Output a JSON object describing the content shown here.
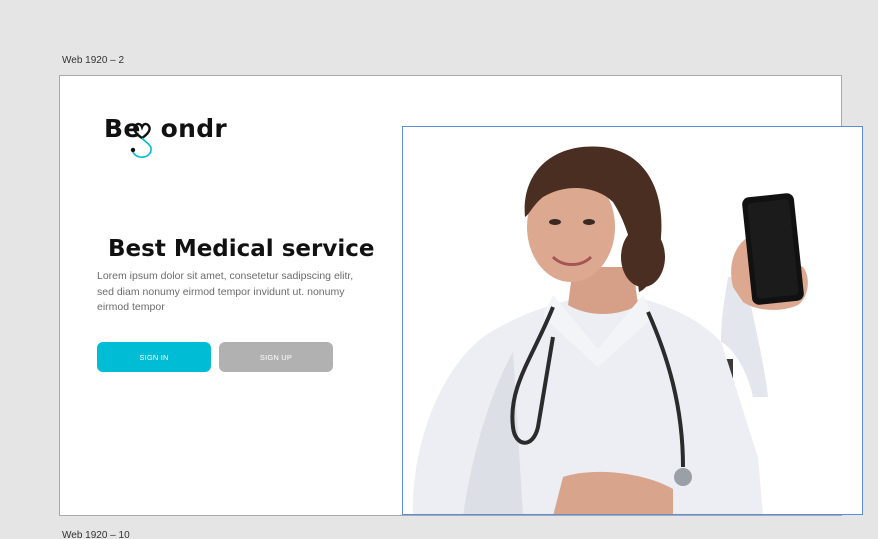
{
  "canvas": {
    "frame_label_top": "Web 1920 – 2",
    "frame_label_bottom": "Web 1920 – 10"
  },
  "logo": {
    "text_start": "Be",
    "text_end": "ondr",
    "accent_color": "#00bcd4"
  },
  "hero": {
    "title": "Best Medical service",
    "body": "Lorem ipsum dolor sit amet, consetetur sadipscing elitr, sed diam nonumy eirmod tempor invidunt ut. nonumy eirmod tempor"
  },
  "buttons": {
    "sign_in": "SIGN IN",
    "sign_up": "SIGN UP",
    "sign_in_color": "#00bcd4",
    "sign_up_color": "#b1b1b1"
  },
  "image": {
    "subject": "doctor-holding-phone-photo"
  }
}
